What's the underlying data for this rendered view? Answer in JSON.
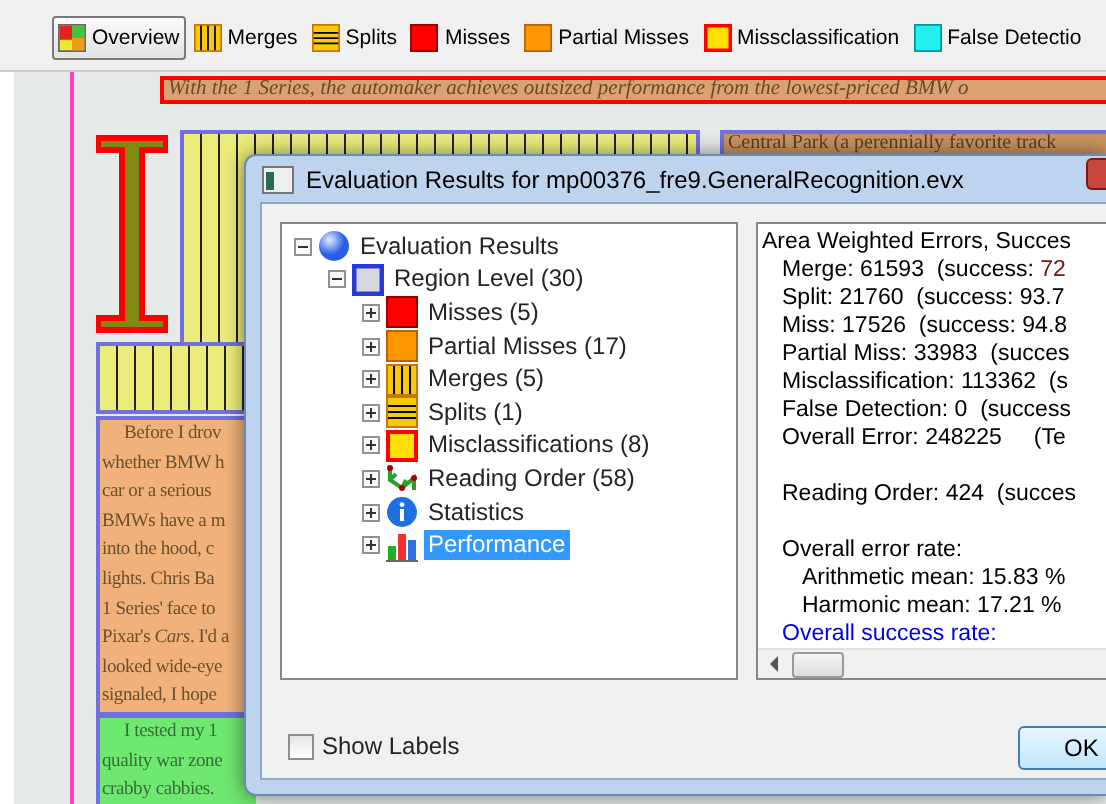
{
  "toolbar": [
    {
      "kind": "overview",
      "label": "Overview",
      "selected": true
    },
    {
      "kind": "merge",
      "label": "Merges",
      "selected": false
    },
    {
      "kind": "split",
      "label": "Splits",
      "selected": false
    },
    {
      "kind": "miss",
      "label": "Misses",
      "selected": false
    },
    {
      "kind": "partial",
      "label": "Partial Misses",
      "selected": false
    },
    {
      "kind": "misclass",
      "label": "Missclassification",
      "selected": false
    },
    {
      "kind": "false",
      "label": "False Detectio",
      "selected": false
    }
  ],
  "document": {
    "headline": "With the 1 Series, the automaker achieves outsized performance from the lowest-priced BMW o",
    "side_line": "Central Park (a perennially favorite track",
    "partial_column": [
      "Before I drov",
      "whether BMW h",
      "car or a serious",
      "BMWs have a m",
      "into the hood, c",
      "lights. Chris Ba",
      "1 Series' face to",
      "Pixar's *Cars*. I'd a",
      "looked wide-eye",
      "signaled, I hope"
    ],
    "green_column": [
      "I tested my 1",
      "quality war zone",
      "crabby cabbies."
    ]
  },
  "dialog": {
    "title": "Evaluation Results for mp00376_fre9.GeneralRecognition.evx",
    "tree": [
      {
        "kind": "globe",
        "label": "Evaluation Results",
        "expanded": true,
        "selected": false,
        "children": [
          {
            "kind": "region",
            "label": "Region Level (30)",
            "expanded": true,
            "selected": false,
            "children": [
              {
                "kind": "miss",
                "label": "Misses (5)",
                "expanded": false,
                "selected": false
              },
              {
                "kind": "partial",
                "label": "Partial Misses (17)",
                "expanded": false,
                "selected": false
              },
              {
                "kind": "merge",
                "label": "Merges (5)",
                "expanded": false,
                "selected": false
              },
              {
                "kind": "split",
                "label": "Splits (1)",
                "expanded": false,
                "selected": false
              },
              {
                "kind": "misclass",
                "label": "Misclassifications (8)",
                "expanded": false,
                "selected": false
              },
              {
                "kind": "reading",
                "label": "Reading Order (58)",
                "expanded": false,
                "selected": false
              },
              {
                "kind": "info",
                "label": "Statistics",
                "expanded": false,
                "selected": false
              },
              {
                "kind": "chart",
                "label": "Performance",
                "expanded": false,
                "selected": true
              }
            ]
          }
        ]
      }
    ],
    "results": [
      {
        "kind": "title",
        "text": "Area Weighted Errors, Succes"
      },
      {
        "kind": "line",
        "text": "Merge: 61593  (success: ",
        "value": "72"
      },
      {
        "kind": "line",
        "text": "Split: 21760  (success: 93.7"
      },
      {
        "kind": "line",
        "text": "Miss: 17526  (success: 94.8"
      },
      {
        "kind": "line",
        "text": "Partial Miss: 33983  (succes"
      },
      {
        "kind": "line",
        "text": "Misclassification: 113362  (s"
      },
      {
        "kind": "line",
        "text": "False Detection: 0  (success"
      },
      {
        "kind": "line",
        "text": "Overall Error: 248225     (Te"
      },
      {
        "kind": "gap"
      },
      {
        "kind": "line",
        "text": "Reading Order: 424  (succes"
      },
      {
        "kind": "gap"
      },
      {
        "kind": "line",
        "text": "Overall error rate:"
      },
      {
        "kind": "sub",
        "text": "Arithmetic mean: 15.83 %"
      },
      {
        "kind": "sub",
        "text": "Harmonic mean: 17.21 %"
      },
      {
        "kind": "link",
        "text": "Overall success rate:"
      }
    ],
    "show_labels": {
      "label": "Show Labels",
      "checked": false
    },
    "ok_button": "OK"
  }
}
